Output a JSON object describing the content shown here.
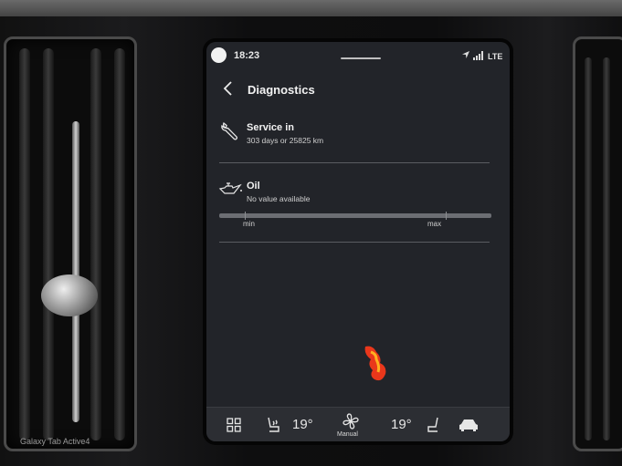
{
  "status_bar": {
    "time": "18:23",
    "network": "LTE",
    "icons": [
      "location-arrow-icon",
      "signal-bars-icon"
    ]
  },
  "header": {
    "title": "Diagnostics",
    "back_icon": "chevron-left-icon"
  },
  "service": {
    "title": "Service in",
    "value": "303 days or 25825 km",
    "icon": "wrench-icon"
  },
  "oil": {
    "title": "Oil",
    "value": "No value available",
    "icon": "oil-can-icon",
    "scale_min": "min",
    "scale_max": "max"
  },
  "climate_bar": {
    "left_temp": "19°",
    "right_temp": "19°",
    "fan_mode": "Manual",
    "icons": [
      "home-grid-icon",
      "driver-seat-icon",
      "fan-icon",
      "passenger-seat-icon",
      "car-icon"
    ]
  },
  "device_caption": "Galaxy Tab Active4",
  "colors": {
    "screen_bg": "#222429",
    "bar_bg": "#2c2e33",
    "text": "#f2f2f2",
    "glare": "#ff3a1a"
  }
}
